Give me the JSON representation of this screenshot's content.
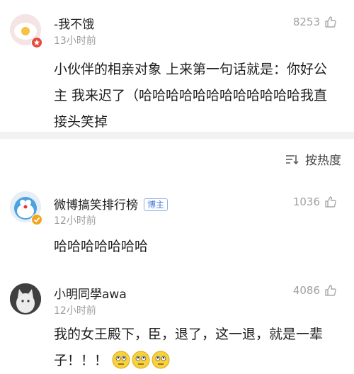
{
  "comments": [
    {
      "user": "-我不饿",
      "time": "13小时前",
      "likes": "8253",
      "text": "小伙伴的相亲对象 上来第一句话就是：你好公主 我来迟了（哈哈哈哈哈哈哈哈哈哈哈哈我直接头笑掉"
    },
    {
      "user": "微博搞笑排行榜",
      "badge": "博主",
      "time": "12小时前",
      "likes": "1036",
      "text": "哈哈哈哈哈哈哈"
    },
    {
      "user": "小明同學awa",
      "time": "12小时前",
      "likes": "4086",
      "text": "我的女王殿下，臣，退了，这一退，就是一辈子！！！",
      "emoji_count": 3
    }
  ],
  "sort": {
    "label": "按热度"
  },
  "colors": {
    "muted": "#9a9a9a",
    "badge": "#4a7bd8",
    "divider": "#f2f2f2"
  },
  "icons": [
    "thumbs-up-icon",
    "sort-icon",
    "verified-icon",
    "awkward-face-emoji"
  ]
}
